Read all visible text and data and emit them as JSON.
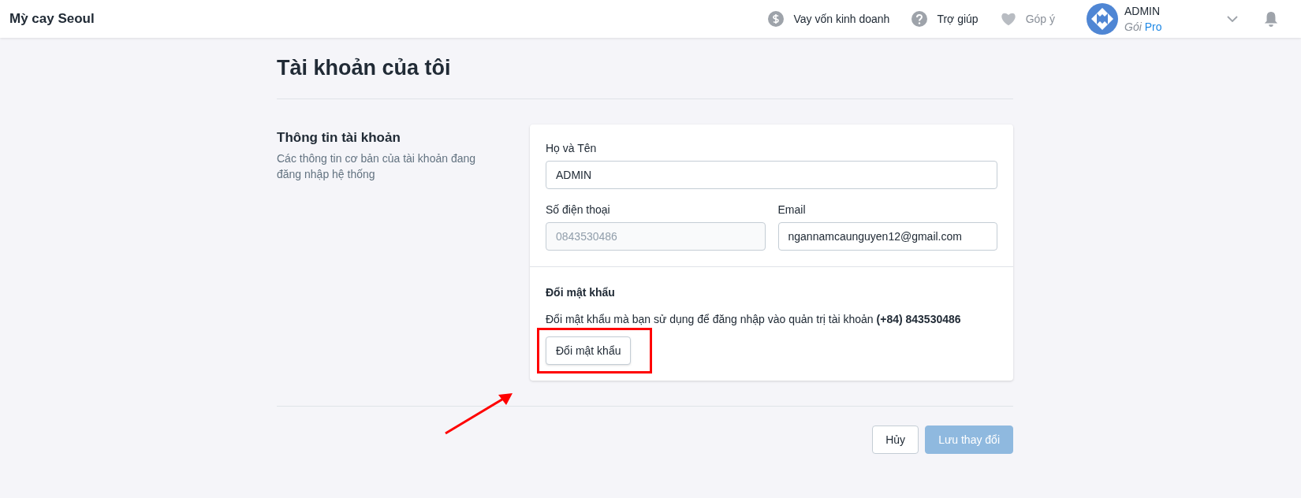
{
  "header": {
    "brand": "Mỳ cay Seoul",
    "links": [
      {
        "kind": "dollar",
        "label": "Vay vốn kinh doanh",
        "disabled": false
      },
      {
        "kind": "help",
        "label": "Trợ giúp",
        "disabled": false
      },
      {
        "kind": "heart",
        "label": "Góp ý",
        "disabled": true
      }
    ],
    "user": {
      "name": "ADMIN",
      "plan_prefix": "Gói",
      "plan": "Pro"
    }
  },
  "page": {
    "title": "Tài khoản của tôi"
  },
  "section": {
    "title": "Thông tin tài khoản",
    "description": "Các thông tin cơ bản của tài khoản đang đăng nhập hệ thống"
  },
  "field_rows": [
    [
      {
        "label": "Họ và Tên",
        "value": "ADMIN",
        "disabled": false
      }
    ],
    [
      {
        "label": "Số điện thoại",
        "value": "0843530486",
        "disabled": true
      },
      {
        "label": "Email",
        "value": "ngannamcaunguyen12@gmail.com",
        "disabled": false
      }
    ]
  ],
  "password": {
    "title": "Đổi mật khẩu",
    "text": "Đổi mật khẩu mà bạn sử dụng để đăng nhập vào quản trị tài khoản **(+84) 843530486**",
    "button": "Đổi mật khẩu",
    "highlighted": true
  },
  "annotation": {
    "arrow": true
  },
  "actions": [
    {
      "label": "Hủy",
      "kind": "secondary",
      "disabled": false
    },
    {
      "label": "Lưu thay đổi",
      "kind": "primary",
      "disabled": true
    }
  ]
}
